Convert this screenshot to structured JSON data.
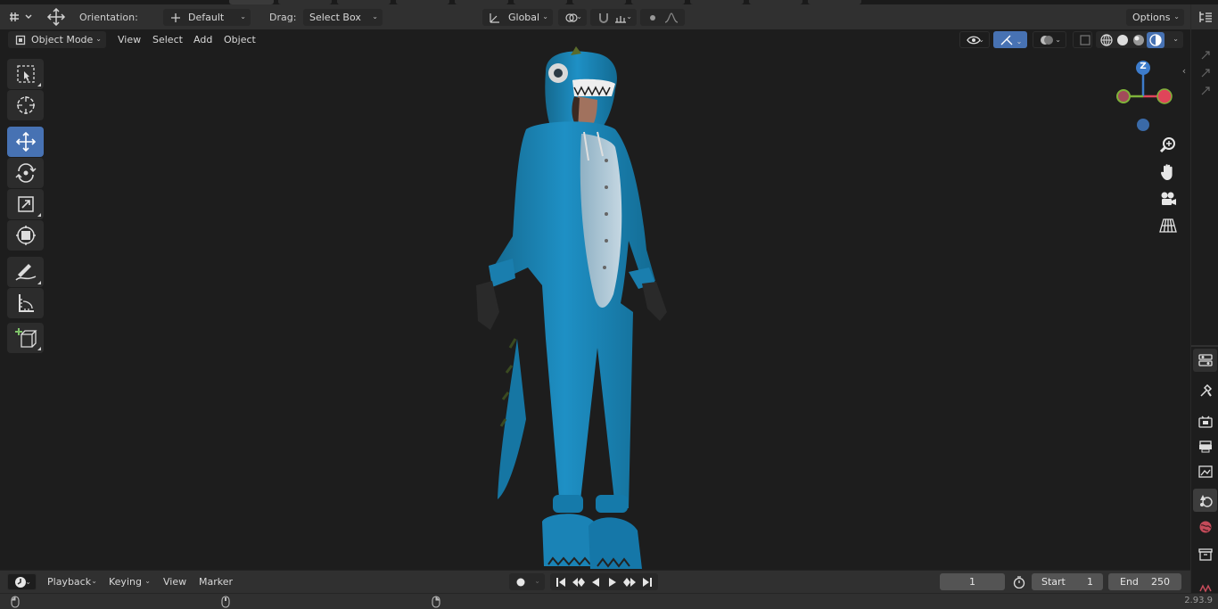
{
  "header": {
    "orientation_label": "Orientation:",
    "orientation_value": "Default",
    "drag_label": "Drag:",
    "drag_value": "Select Box",
    "transform_orientation": "Global",
    "options_label": "Options"
  },
  "viewport_menu": {
    "mode": "Object Mode",
    "view": "View",
    "select": "Select",
    "add": "Add",
    "object": "Object"
  },
  "gizmo": {
    "z_label": "Z"
  },
  "timeline": {
    "playback": "Playback",
    "keying": "Keying",
    "view": "View",
    "marker": "Marker",
    "current_frame": "1",
    "start_label": "Start",
    "start_value": "1",
    "end_label": "End",
    "end_value": "250"
  },
  "status": {
    "version": "2.93.9"
  },
  "icons": {
    "tools": [
      "select-box-icon",
      "cursor-icon",
      "move-icon",
      "rotate-icon",
      "scale-icon",
      "transform-icon",
      "annotate-icon",
      "measure-icon",
      "add-cube-icon"
    ],
    "navigation": [
      "zoom-icon",
      "hand-pan-icon",
      "camera-icon",
      "grid-perspective-icon"
    ],
    "properties_tabs": [
      "tool-icon",
      "render-icon",
      "output-icon",
      "view-layer-icon",
      "scene-icon",
      "world-icon",
      "collection-icon"
    ]
  },
  "colors": {
    "accent": "#4772b3",
    "x_axis": "#e0455a",
    "y_axis": "#7fb33a",
    "z_axis": "#3d7ccc",
    "onesie": "#1d8fc4"
  }
}
